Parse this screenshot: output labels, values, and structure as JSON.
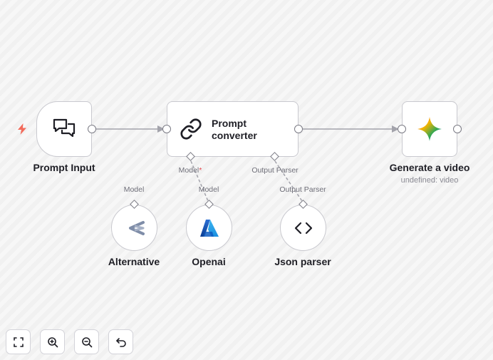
{
  "nodes": {
    "prompt_input": {
      "label": "Prompt Input",
      "icon": "chat-bubbles-icon"
    },
    "prompt_converter": {
      "label_line1": "Prompt",
      "label_line2": "converter",
      "icon": "link-icon"
    },
    "generate_video": {
      "label": "Generate a video",
      "sublabel": "undefined: video",
      "icon": "gemini-star-icon"
    },
    "alternative": {
      "label": "Alternative",
      "input_label": "Model",
      "icon": "alternative-logo-icon"
    },
    "openai": {
      "label": "Openai",
      "input_label": "Model",
      "icon": "azure-logo-icon"
    },
    "json_parser": {
      "label": "Json parser",
      "input_label": "Output Parser",
      "icon": "code-brackets-icon"
    }
  },
  "ports": {
    "model": "Model",
    "model_required_mark": "*",
    "output_parser": "Output Parser"
  },
  "controls": [
    {
      "name": "fit-view",
      "icon": "fullscreen-icon"
    },
    {
      "name": "zoom-in",
      "icon": "zoom-in-icon"
    },
    {
      "name": "zoom-out",
      "icon": "zoom-out-icon"
    },
    {
      "name": "undo",
      "icon": "undo-icon"
    }
  ],
  "colors": {
    "trigger_bolt": "#f26b5b",
    "edge": "#a3a3ab",
    "port_border": "#7b7b85"
  }
}
